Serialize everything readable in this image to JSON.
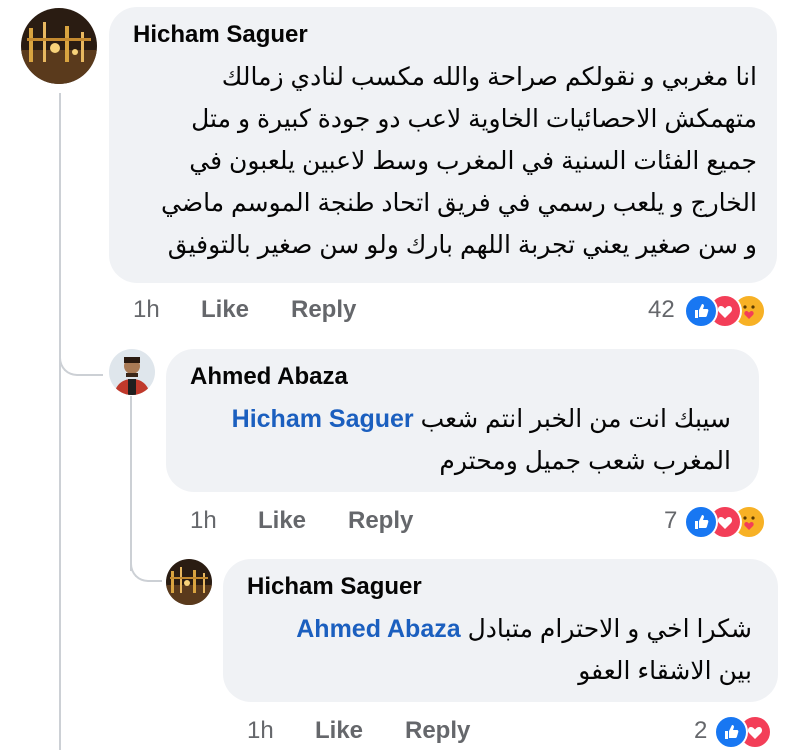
{
  "comments": [
    {
      "author": "Hicham Saguer",
      "lines": [
        "انا مغربي و نقولكم صراحة والله مكسب لنادي زمالك",
        "متهمكش الاحصائيات الخاوية لاعب دو جودة كبيرة و متل",
        "جميع الفئات السنية في المغرب وسط لاعبين يلعبون في",
        "الخارج و يلعب رسمي في فريق اتحاد طنجة الموسم ماضي",
        "و سن صغير يعني تجربة اللهم بارك ولو سن صغير بالتوفيق"
      ],
      "time": "1h",
      "like": "Like",
      "reply": "Reply",
      "reaction_count": "42"
    },
    {
      "author": "Ahmed Abaza",
      "mention": "Hicham Saguer",
      "line1_text": "سيبك انت من الخبر انتم شعب",
      "line2": "المغرب شعب جميل ومحترم",
      "time": "1h",
      "like": "Like",
      "reply": "Reply",
      "reaction_count": "7"
    },
    {
      "author": "Hicham Saguer",
      "mention": "Ahmed Abaza",
      "line1_text": "شكرا اخي و الاحترام متبادل",
      "line2": "بين الاشقاء العفو",
      "time": "1h",
      "like": "Like",
      "reply": "Reply",
      "reaction_count": "2"
    }
  ],
  "reaction_icons": [
    "like-icon",
    "love-icon",
    "care-icon"
  ],
  "colors": {
    "bubble": "#f0f2f5",
    "mention": "#1b5fbf",
    "meta": "#65676b",
    "like": "#1877f2",
    "love": "#f33e58",
    "care": "#f7b125"
  }
}
